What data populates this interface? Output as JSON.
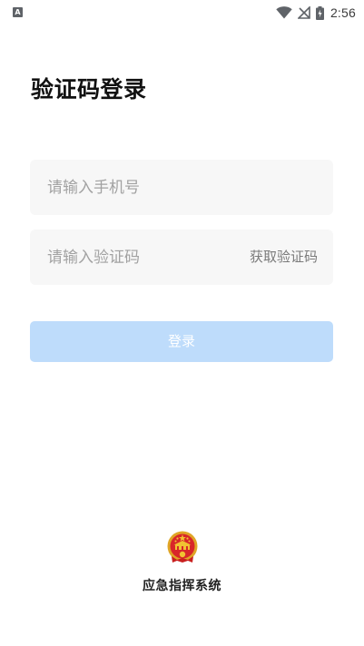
{
  "status_bar": {
    "notification_icon": "a-notification-icon",
    "notification_glyph": "A",
    "icons": [
      "wifi-icon",
      "signal-off-icon",
      "battery-charging-icon"
    ],
    "time": "2:56"
  },
  "login": {
    "title": "验证码登录",
    "phone_placeholder": "请输入手机号",
    "code_placeholder": "请输入验证码",
    "get_code_label": "获取验证码",
    "submit_label": "登录",
    "submit_color": "#bedcfb"
  },
  "footer": {
    "emblem_icon": "national-emblem-icon",
    "system_name": "应急指挥系统"
  }
}
